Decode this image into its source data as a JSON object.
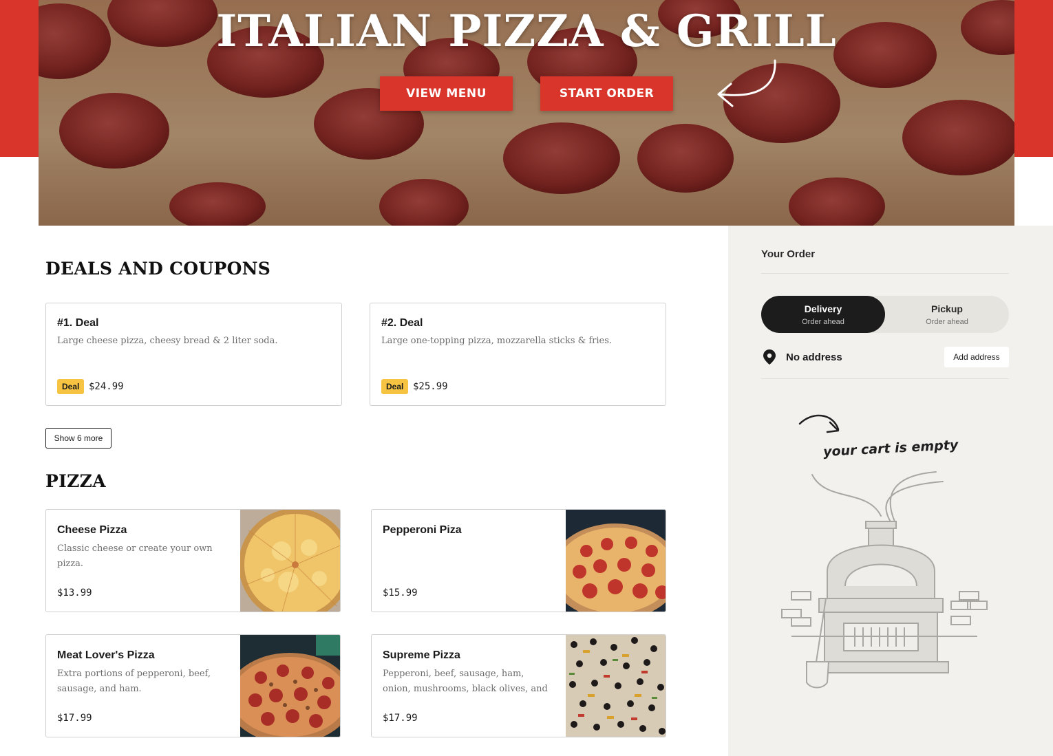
{
  "hero": {
    "title": "ITALIAN PIZZA & GRILL",
    "view_menu_label": "VIEW MENU",
    "start_order_label": "START ORDER"
  },
  "deals": {
    "title": "DEALS AND COUPONS",
    "show_more_label": "Show 6 more",
    "items": [
      {
        "name": "#1. Deal",
        "description": "Large cheese pizza, cheesy bread & 2 liter soda.",
        "badge": "Deal",
        "price": "$24.99"
      },
      {
        "name": "#2. Deal",
        "description": "Large one-topping pizza, mozzarella sticks & fries.",
        "badge": "Deal",
        "price": "$25.99"
      }
    ]
  },
  "pizza": {
    "title": "PIZZA",
    "items": [
      {
        "name": "Cheese Pizza",
        "description": "Classic cheese or create your own pizza.",
        "price": "$13.99",
        "photo": "cheese-pizza-photo"
      },
      {
        "name": "Pepperoni Piza",
        "description": "",
        "price": "$15.99",
        "photo": "pepperoni-pizza-photo"
      },
      {
        "name": "Meat Lover's Pizza",
        "description": "Extra portions of pepperoni, beef, sausage, and ham.",
        "price": "$17.99",
        "photo": "meat-lovers-pizza-photo"
      },
      {
        "name": "Supreme Pizza",
        "description": "Pepperoni, beef, sausage, ham, onion, mushrooms, black olives, and green…",
        "price": "$17.99",
        "photo": "supreme-pizza-photo"
      }
    ]
  },
  "order": {
    "title": "Your Order",
    "delivery_label": "Delivery",
    "delivery_sub": "Order ahead",
    "pickup_label": "Pickup",
    "pickup_sub": "Order ahead",
    "address_label": "No address",
    "add_address_label": "Add address",
    "empty_cart_text": "your cart is empty"
  },
  "colors": {
    "brand_red": "#d9352a",
    "deal_badge": "#f6c343",
    "sidebar_bg": "#f2f1ee",
    "toggle_active": "#1c1c1c"
  },
  "icons": [
    "curved-arrow-icon",
    "location-pin-icon",
    "pizza-oven-illustration"
  ]
}
